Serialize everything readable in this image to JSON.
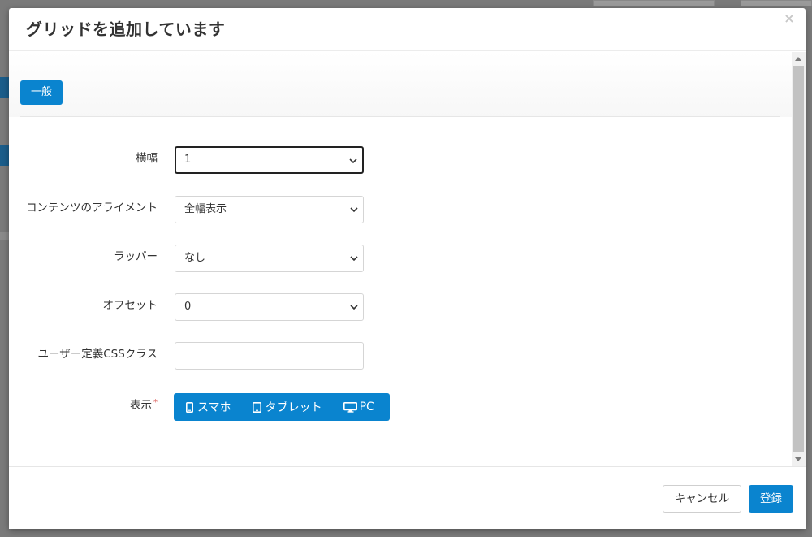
{
  "modal": {
    "title": "グリッドを追加しています",
    "close_icon": "×"
  },
  "tabs": [
    {
      "label": "一般",
      "active": true
    }
  ],
  "form": {
    "width": {
      "label": "横幅",
      "value": "1"
    },
    "alignment": {
      "label": "コンテンツのアライメント",
      "value": "全幅表示"
    },
    "wrapper": {
      "label": "ラッパー",
      "value": "なし"
    },
    "offset": {
      "label": "オフセット",
      "value": "0"
    },
    "css_class": {
      "label": "ユーザー定義CSSクラス",
      "value": "",
      "placeholder": ""
    },
    "display": {
      "label": "表示",
      "required_mark": "*",
      "options": [
        {
          "label": "スマホ",
          "icon": "smartphone-icon"
        },
        {
          "label": "タブレット",
          "icon": "tablet-icon"
        },
        {
          "label": "PC",
          "icon": "desktop-icon"
        }
      ]
    }
  },
  "footer": {
    "cancel_label": "キャンセル",
    "submit_label": "登録"
  },
  "colors": {
    "primary": "#0a84cf",
    "required": "#d9534f",
    "overlay": "#6b6b6b"
  }
}
